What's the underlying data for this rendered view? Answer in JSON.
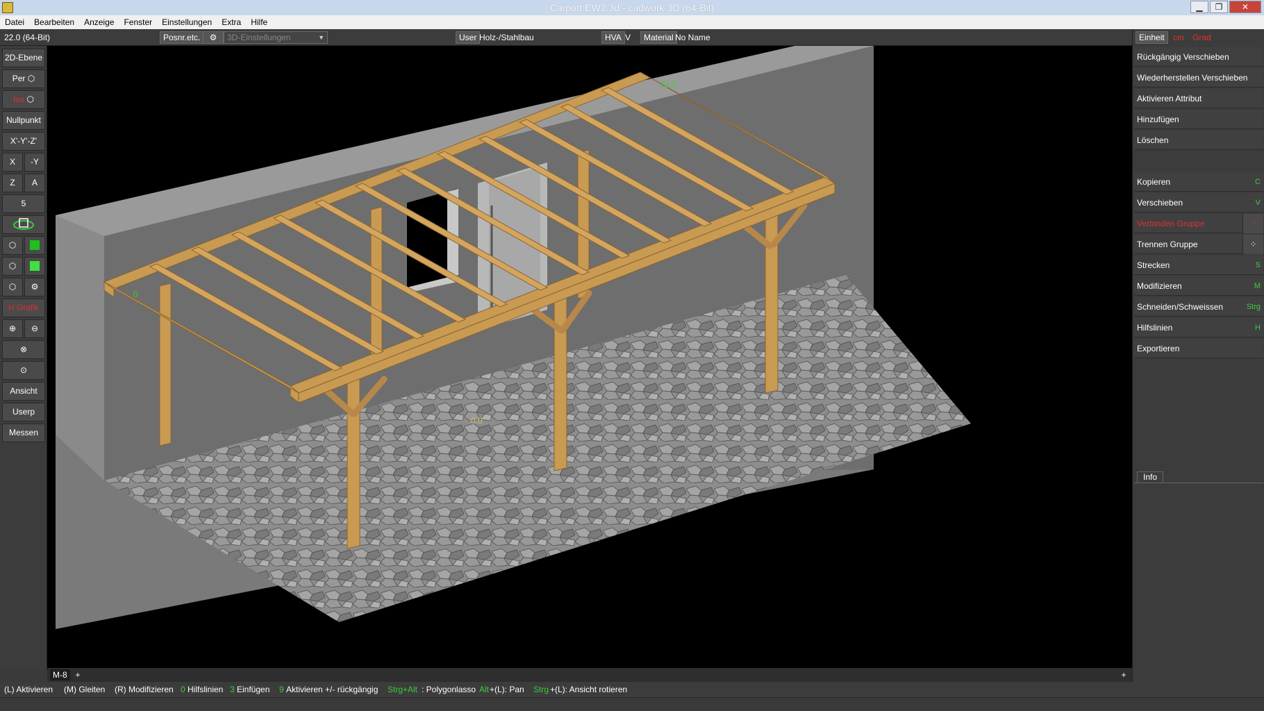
{
  "window": {
    "title": "Carport EW2.3d - cadwork 3D (64-Bit)",
    "minimize_glyph": "▁",
    "restore_glyph": "❐",
    "close_glyph": "✕"
  },
  "menu": [
    "Datei",
    "Bearbeiten",
    "Anzeige",
    "Fenster",
    "Einstellungen",
    "Extra",
    "Hilfe"
  ],
  "infobar": {
    "version": "22.0 (64-Bit)",
    "posnr_button": "Posnr.etc.",
    "settings_dropdown": "3D-Einstellungen",
    "user_button": "User",
    "user_value": "Holz-/Stahlbau",
    "hva_button": "HVA",
    "hva_value": "V",
    "material_button": "Material",
    "material_value": "No Name"
  },
  "left_toolbar": {
    "ebene": "2D-Ebene",
    "per": "Per",
    "iso": "Iso",
    "nullpunkt": "Nullpunkt",
    "xyz": "X'-Y'-Z'",
    "x": "X",
    "minus_y": "-Y",
    "z": "Z",
    "a": "A",
    "five": "5",
    "zoom_in_icon": "zoom-in-icon",
    "zoom_out_icon": "zoom-out-icon",
    "ansicht": "Ansicht",
    "userp": "Userp",
    "messen": "Messen",
    "red_label": "H Grafik"
  },
  "viewport": {
    "label_top": "73.0",
    "label_left": "0",
    "label_center": "0.0"
  },
  "right_panel": {
    "einheit_button": "Einheit",
    "einheit_value": "cm",
    "einheit_value2": "Grad",
    "commands": [
      {
        "label": "Rückgängig Verschieben",
        "key": ""
      },
      {
        "label": "Wiederherstellen Verschieben",
        "key": ""
      },
      {
        "label": "Aktivieren Attribut",
        "key": ""
      },
      {
        "label": "Hinzufügen",
        "key": ""
      },
      {
        "label": "Löschen",
        "key": ""
      }
    ],
    "commands2": [
      {
        "label": "Kopieren",
        "key": "C"
      },
      {
        "label": "Verschieben",
        "key": "V"
      },
      {
        "label": "Verbinden Gruppe",
        "key": ""
      },
      {
        "label": "Trennen Gruppe",
        "key": ""
      },
      {
        "label": "Strecken",
        "key": "S"
      },
      {
        "label": "Modifizieren",
        "key": "M"
      },
      {
        "label": "Schneiden/Schweissen",
        "key": "Strg"
      },
      {
        "label": "Hilfslinien",
        "key": "H"
      },
      {
        "label": "Exportieren",
        "key": ""
      }
    ],
    "info_tab": "Info"
  },
  "tabs": {
    "active_tab": "M-8",
    "add_tab": "+",
    "add_right": "+"
  },
  "statusbar": {
    "s1": "(L) Aktivieren",
    "s2": "(M) Gleiten",
    "s3": "(R) Modifizieren",
    "s4_key": "0",
    "s4": "Hilfslinien",
    "s5_key": "3",
    "s5": "Einfügen",
    "s6_key": "9",
    "s6": "Aktivieren +/- rückgängig",
    "s7_key": "Strg+Alt",
    "s7": ": Polygonlasso",
    "s8_key": "Alt",
    "s8": "+(L): Pan",
    "s9_key": "Strg",
    "s9": "+(L): Ansicht rotieren"
  },
  "colors": {
    "wood": "#c99a52",
    "wood_dark": "#9c7238",
    "wall": "#777777",
    "floor": "#8d8d8d",
    "accent_green": "#3ccc3c",
    "accent_red": "#e03030"
  }
}
